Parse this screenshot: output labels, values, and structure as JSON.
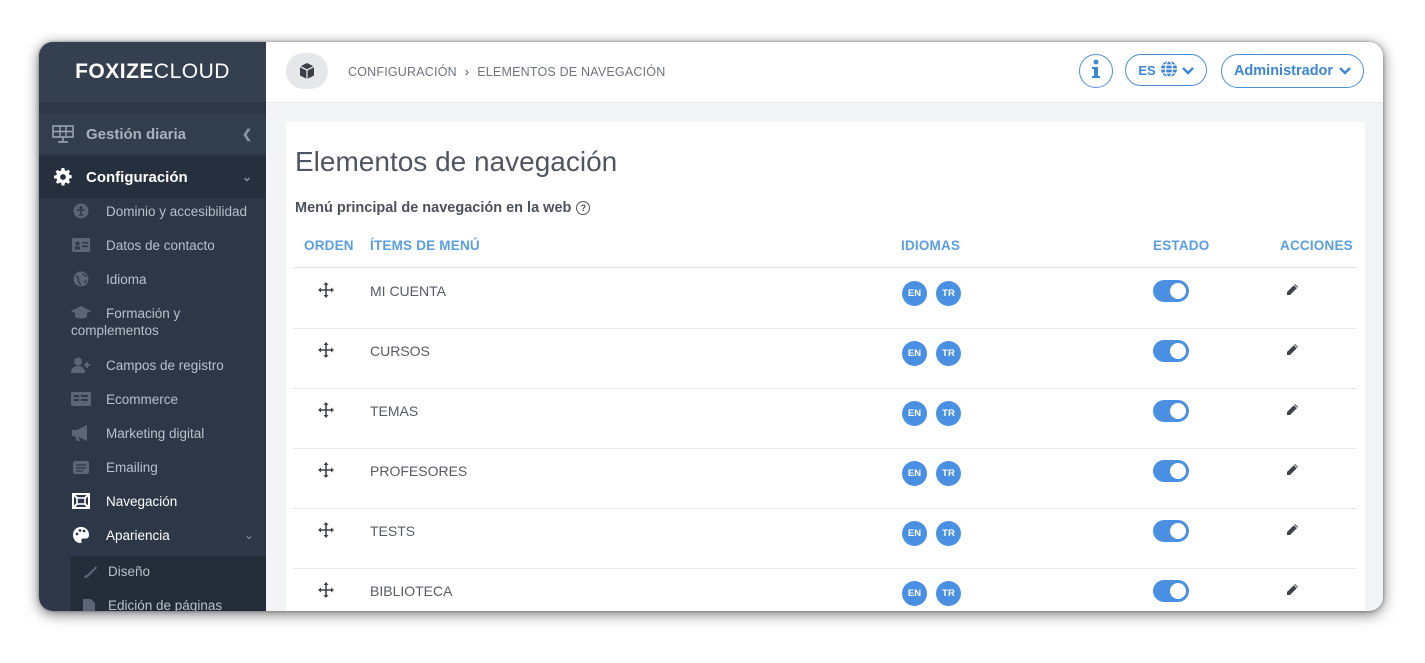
{
  "app": {
    "logo_bold": "FOXIZE",
    "logo_light": "CLOUD"
  },
  "sidebar": {
    "group1": {
      "label": "Gestión diaria",
      "icon": "solar-panel-icon"
    },
    "group2": {
      "label": "Configuración",
      "icon": "gear-icon"
    },
    "items": [
      {
        "label": "Dominio y accesibilidad",
        "icon": "accessibility-icon"
      },
      {
        "label": "Datos de contacto",
        "icon": "id-card-icon"
      },
      {
        "label": "Idioma",
        "icon": "globe-icon"
      },
      {
        "label_line1": "Formación y",
        "label_line2": "complementos",
        "icon": "graduation-cap-icon"
      },
      {
        "label": "Campos de registro",
        "icon": "user-plus-icon"
      },
      {
        "label": "Ecommerce",
        "icon": "money-icon"
      },
      {
        "label": "Marketing digital",
        "icon": "megaphone-icon"
      },
      {
        "label": "Emailing",
        "icon": "mail-icon"
      },
      {
        "label": "Navegación",
        "icon": "navigation-frame-icon"
      },
      {
        "label": "Apariencia",
        "icon": "palette-icon"
      }
    ],
    "subitems": [
      {
        "label": "Diseño",
        "icon": "brush-icon"
      },
      {
        "label": "Edición de páginas",
        "icon": "file-icon"
      }
    ]
  },
  "header": {
    "breadcrumb": [
      "CONFIGURACIÓN",
      "ELEMENTOS DE NAVEGACIÓN"
    ],
    "lang_label": "ES",
    "user_label": "Administrador"
  },
  "main": {
    "title": "Elementos de navegación",
    "section_title": "Menú principal de navegación en la web",
    "columns": [
      "ORDEN",
      "ÍTEMS DE MENÚ",
      "IDIOMAS",
      "ESTADO",
      "ACCIONES"
    ],
    "rows": [
      {
        "label": "MI CUENTA",
        "langs": [
          "EN",
          "TR"
        ],
        "enabled": true
      },
      {
        "label": "CURSOS",
        "langs": [
          "EN",
          "TR"
        ],
        "enabled": true
      },
      {
        "label": "TEMAS",
        "langs": [
          "EN",
          "TR"
        ],
        "enabled": true
      },
      {
        "label": "PROFESORES",
        "langs": [
          "EN",
          "TR"
        ],
        "enabled": true
      },
      {
        "label": "TESTS",
        "langs": [
          "EN",
          "TR"
        ],
        "enabled": true
      },
      {
        "label": "BIBLIOTECA",
        "langs": [
          "EN",
          "TR"
        ],
        "enabled": true
      }
    ]
  },
  "colors": {
    "sidebar": "#2d3747",
    "accent": "#4a90e2"
  }
}
